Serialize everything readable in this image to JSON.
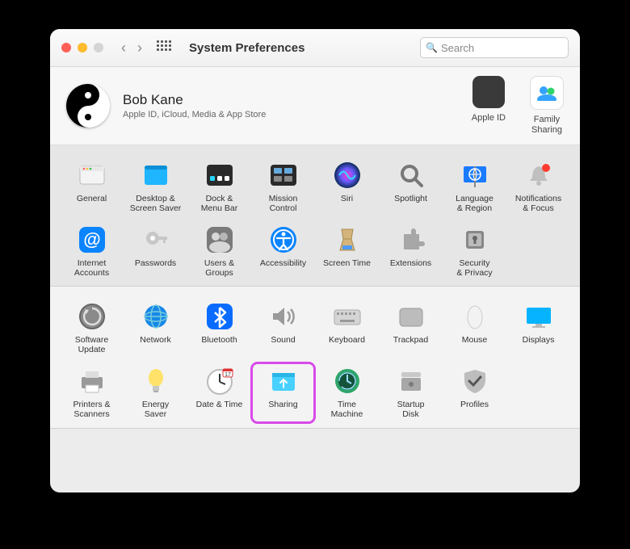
{
  "window": {
    "title": "System Preferences"
  },
  "search": {
    "placeholder": "Search"
  },
  "user": {
    "name": "Bob Kane",
    "subtitle": "Apple ID, iCloud, Media & App Store"
  },
  "account_shortcuts": {
    "apple_id": "Apple ID",
    "family": "Family\nSharing"
  },
  "prefs1": [
    {
      "id": "general",
      "label": "General"
    },
    {
      "id": "desktop",
      "label": "Desktop &\nScreen Saver"
    },
    {
      "id": "dock",
      "label": "Dock &\nMenu Bar"
    },
    {
      "id": "mission",
      "label": "Mission\nControl"
    },
    {
      "id": "siri",
      "label": "Siri"
    },
    {
      "id": "spotlight",
      "label": "Spotlight"
    },
    {
      "id": "language",
      "label": "Language\n& Region"
    },
    {
      "id": "notifications",
      "label": "Notifications\n& Focus"
    },
    {
      "id": "internet",
      "label": "Internet\nAccounts"
    },
    {
      "id": "passwords",
      "label": "Passwords"
    },
    {
      "id": "users",
      "label": "Users &\nGroups"
    },
    {
      "id": "accessibility",
      "label": "Accessibility"
    },
    {
      "id": "screentime",
      "label": "Screen Time"
    },
    {
      "id": "extensions",
      "label": "Extensions"
    },
    {
      "id": "security",
      "label": "Security\n& Privacy"
    }
  ],
  "prefs2": [
    {
      "id": "software",
      "label": "Software\nUpdate"
    },
    {
      "id": "network",
      "label": "Network"
    },
    {
      "id": "bluetooth",
      "label": "Bluetooth"
    },
    {
      "id": "sound",
      "label": "Sound"
    },
    {
      "id": "keyboard",
      "label": "Keyboard"
    },
    {
      "id": "trackpad",
      "label": "Trackpad"
    },
    {
      "id": "mouse",
      "label": "Mouse"
    },
    {
      "id": "displays",
      "label": "Displays"
    },
    {
      "id": "printers",
      "label": "Printers &\nScanners"
    },
    {
      "id": "energy",
      "label": "Energy\nSaver"
    },
    {
      "id": "datetime",
      "label": "Date & Time"
    },
    {
      "id": "sharing",
      "label": "Sharing"
    },
    {
      "id": "timemachine",
      "label": "Time\nMachine"
    },
    {
      "id": "startup",
      "label": "Startup\nDisk"
    },
    {
      "id": "profiles",
      "label": "Profiles"
    }
  ],
  "highlighted": "sharing"
}
